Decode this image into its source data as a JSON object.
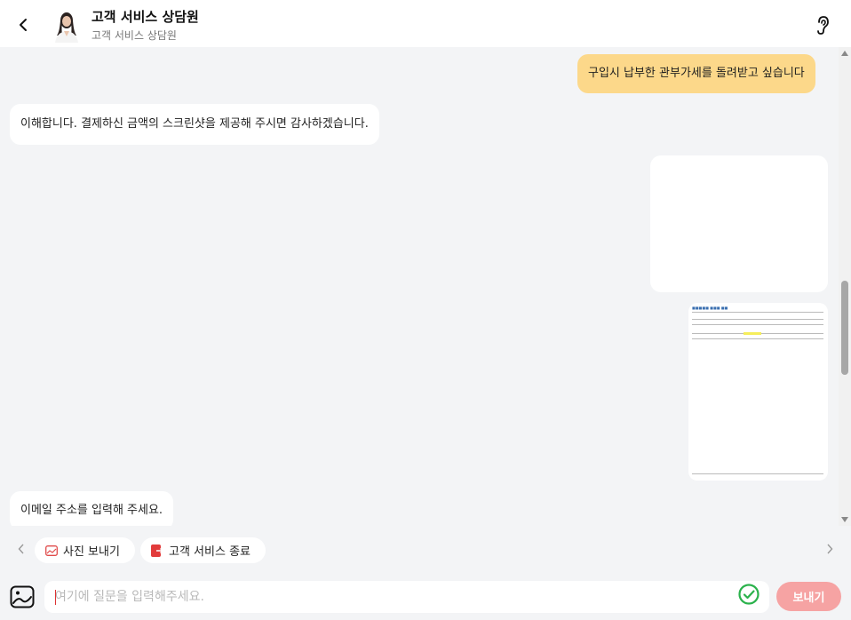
{
  "header": {
    "title": "고객 서비스 상담원",
    "subtitle": "고객 서비스 상담원",
    "back_icon": "chevron-left-icon",
    "ear_icon": "ear-icon"
  },
  "messages": [
    {
      "role": "user",
      "text": "구입시 납부한 관부가세를 돌려받고 싶습니다"
    },
    {
      "role": "agent",
      "text": "이해합니다. 결제하신 금액의 스크린샷을 제공해 주시면 감사하겠습니다."
    },
    {
      "role": "user",
      "type": "image"
    },
    {
      "role": "user",
      "type": "image-document"
    },
    {
      "role": "agent",
      "text": "이메일 주소를 입력해 주세요."
    }
  ],
  "quick_actions": [
    {
      "label": "사진 보내기",
      "icon": "image-icon"
    },
    {
      "label": "고객 서비스 종료",
      "icon": "exit-icon"
    }
  ],
  "input": {
    "placeholder": "여기에 질문을 입력해주세요.",
    "value": "",
    "send_label": "보내기"
  },
  "colors": {
    "user_bubble": "#fcd88a",
    "agent_bubble": "#ffffff",
    "background": "#f3f4f6",
    "send_button": "#f6a3a3",
    "check": "#2bb24c"
  }
}
